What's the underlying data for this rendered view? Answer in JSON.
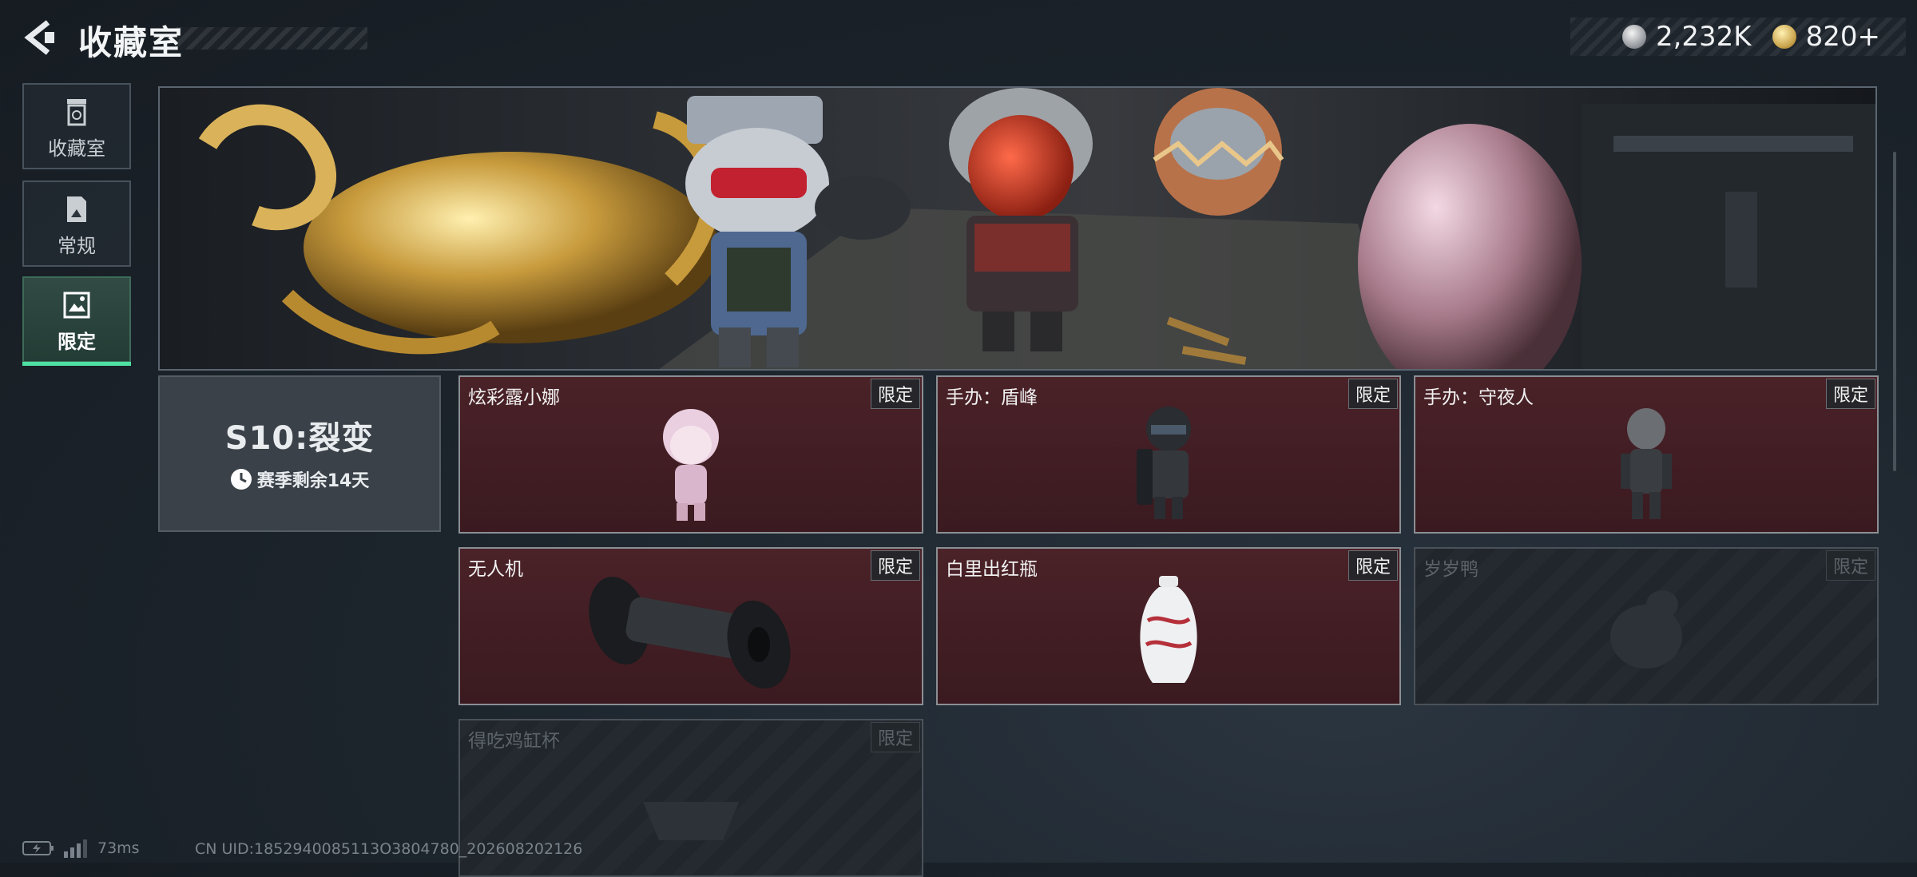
{
  "header": {
    "title": "收藏室",
    "currencies": [
      {
        "icon": "silver-coin-icon",
        "value": "2,232K"
      },
      {
        "icon": "gold-coin-icon",
        "value": "820+"
      }
    ]
  },
  "sidebar": {
    "items": [
      {
        "label": "收藏室",
        "icon": "trash-bin-icon",
        "active": false
      },
      {
        "label": "常规",
        "icon": "document-icon",
        "active": false
      },
      {
        "label": "限定",
        "icon": "photo-frame-icon",
        "active": true
      }
    ]
  },
  "season": {
    "title": "S10:裂变",
    "remaining": "赛季剩余14天"
  },
  "items": [
    {
      "name": "炫彩露小娜",
      "tag": "限定",
      "locked": false
    },
    {
      "name": "手办：盾峰",
      "tag": "限定",
      "locked": false
    },
    {
      "name": "手办：守夜人",
      "tag": "限定",
      "locked": false
    },
    {
      "name": "无人机",
      "tag": "限定",
      "locked": false
    },
    {
      "name": "白里出红瓶",
      "tag": "限定",
      "locked": false
    },
    {
      "name": "岁岁鸭",
      "tag": "限定",
      "locked": true
    },
    {
      "name": "得吃鸡缸杯",
      "tag": "限定",
      "locked": true
    }
  ],
  "footer": {
    "ping": "73ms",
    "uid": "CN UID:1852940085113O3804780_202608202126"
  },
  "colors": {
    "accent": "#4fe0a4",
    "card_bg": "#4a2228",
    "page_bg": "#1d252d"
  }
}
